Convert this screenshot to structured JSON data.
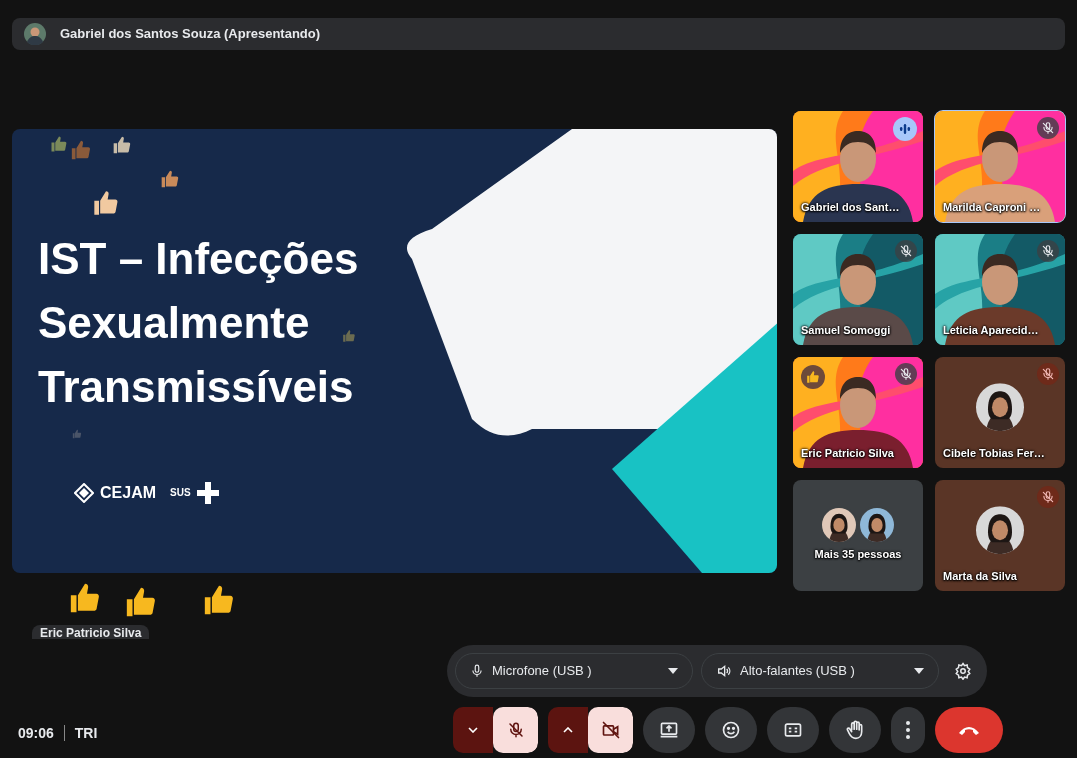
{
  "presenter_bar": {
    "title": "Gabriel dos Santos Souza (Apresentando)"
  },
  "slide": {
    "title_lines": [
      "IST – Infecções",
      "Sexualmente",
      "Transmissíveis"
    ],
    "logo_texts": [
      "CEJAM",
      "SUS"
    ]
  },
  "reaction_labels": [
    "Eric Patricio Silva"
  ],
  "tiles": [
    {
      "kind": "video",
      "name": "Gabriel dos Sant…",
      "muted": false,
      "speaking": true,
      "selected": false,
      "reaction": false
    },
    {
      "kind": "video",
      "name": "Marilda Caproni …",
      "muted": true,
      "speaking": false,
      "selected": true,
      "reaction": false
    },
    {
      "kind": "video",
      "name": "Samuel Somoggi",
      "muted": true,
      "speaking": false,
      "selected": false,
      "reaction": false
    },
    {
      "kind": "video",
      "name": "Leticia Aparecid…",
      "muted": true,
      "speaking": false,
      "selected": false,
      "reaction": false
    },
    {
      "kind": "video",
      "name": "Eric Patricio Silva",
      "muted": true,
      "speaking": false,
      "selected": false,
      "reaction": true
    },
    {
      "kind": "avatar",
      "name": "Cibele Tobias Fer…",
      "muted": true,
      "speaking": false,
      "selected": false,
      "reaction": false
    },
    {
      "kind": "overflow",
      "name": "Mais 35 pessoas",
      "muted": false,
      "speaking": false,
      "selected": false,
      "reaction": false
    },
    {
      "kind": "avatar",
      "name": "Marta da Silva",
      "muted": true,
      "speaking": false,
      "selected": false,
      "reaction": false
    }
  ],
  "devices": [
    {
      "kind": "mic",
      "label": "Microfone (USB )"
    },
    {
      "kind": "speaker",
      "label": "Alto-falantes (USB )"
    }
  ],
  "clock": {
    "time": "09:06",
    "code": "TRI"
  },
  "controls": [
    {
      "kind": "mic",
      "off": true
    },
    {
      "kind": "camera",
      "off": true
    },
    {
      "kind": "present"
    },
    {
      "kind": "emoji"
    },
    {
      "kind": "captions"
    },
    {
      "kind": "hand"
    },
    {
      "kind": "more"
    },
    {
      "kind": "leave"
    }
  ]
}
